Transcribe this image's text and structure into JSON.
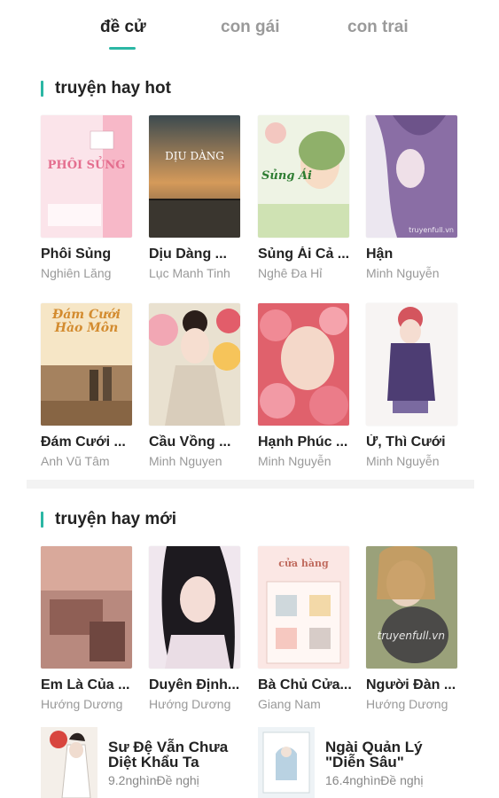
{
  "tabs": [
    {
      "label": "đề cử",
      "active": true
    },
    {
      "label": "con gái",
      "active": false
    },
    {
      "label": "con trai",
      "active": false
    }
  ],
  "accent_color": "#2bb7a4",
  "hot": {
    "title": "truyện hay hot",
    "books": [
      {
        "title": "Phôi Sủng",
        "author": "Nghiên Lăng",
        "cover_text": "PHÔI SỦNG"
      },
      {
        "title": "Dịu Dàng ...",
        "author": "Lục Manh Tinh",
        "cover_text": "DỊU DÀNG"
      },
      {
        "title": "Sủng Ái Cả ...",
        "author": "Nghê Đa Hỉ",
        "cover_text": "Sủng Ái"
      },
      {
        "title": "Hận",
        "author": "Minh Nguyễn",
        "cover_text": "truyenfull.vn"
      },
      {
        "title": "Đám Cưới ...",
        "author": "Anh Vũ Tâm",
        "cover_text": "Đám Cưới Hào Môn"
      },
      {
        "title": "Cầu Vồng ...",
        "author": "Minh Nguyen",
        "cover_text": ""
      },
      {
        "title": "Hạnh Phúc ...",
        "author": "Minh Nguyễn",
        "cover_text": ""
      },
      {
        "title": "Ừ, Thì Cưới",
        "author": "Minh Nguyễn",
        "cover_text": ""
      }
    ]
  },
  "new": {
    "title": "truyện hay mới",
    "books": [
      {
        "title": "Em Là Của ...",
        "author": "Hướng Dương",
        "cover_text": ""
      },
      {
        "title": "Duyên Định...",
        "author": "Hướng Dương",
        "cover_text": ""
      },
      {
        "title": "Bà Chủ Cửa...",
        "author": "Giang Nam",
        "cover_text": "cửa hàng"
      },
      {
        "title": "Người Đàn ...",
        "author": "Hướng Dương",
        "cover_text": "truyenfull.vn"
      }
    ],
    "list": [
      {
        "title": "Sư Đệ Vẫn Chưa Diệt Khẩu Ta",
        "meta": "9.2nghìnĐề nghị"
      },
      {
        "title": "Ngài Quản Lý \"Diễn Sâu\"",
        "meta": "16.4nghìnĐề nghị"
      }
    ]
  }
}
